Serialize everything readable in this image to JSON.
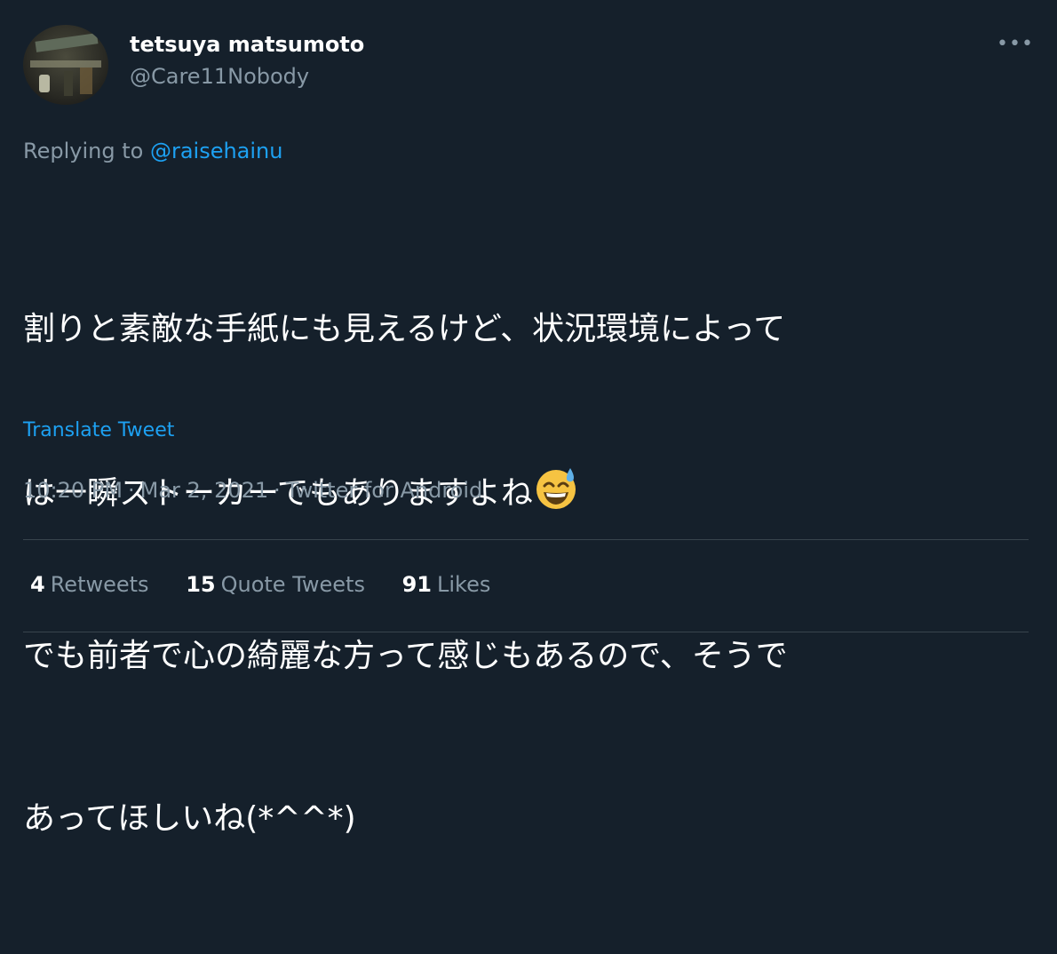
{
  "user": {
    "name": "tetsuya matsumoto",
    "handle": "@Care11Nobody"
  },
  "more_icon": "more-horizontal-icon",
  "reply": {
    "prefix": "Replying to",
    "mention": "@raisehainu"
  },
  "tweet": {
    "line1": "割りと素敵な手紙にも見えるけど、状況環境によって",
    "line2": "は一瞬ストーカーでもありますよね",
    "line2_emoji": "grinning-face-with-sweat-emoji",
    "line3": "でも前者で心の綺麗な方って感じもあるので、そうで",
    "line4": "あってほしいね(*^^*)"
  },
  "translate_label": "Translate Tweet",
  "meta": {
    "time": "10:20 PM",
    "date": "Mar 2, 2021",
    "source": "Twitter for Android",
    "separator": "·"
  },
  "stats": {
    "retweets_count": "4",
    "retweets_label": "Retweets",
    "quotes_count": "15",
    "quotes_label": "Quote Tweets",
    "likes_count": "91",
    "likes_label": "Likes"
  },
  "colors": {
    "background": "#15202b",
    "primary_text": "#ffffff",
    "secondary_text": "#8899a6",
    "accent": "#1da1f2",
    "divider": "#38444d"
  }
}
